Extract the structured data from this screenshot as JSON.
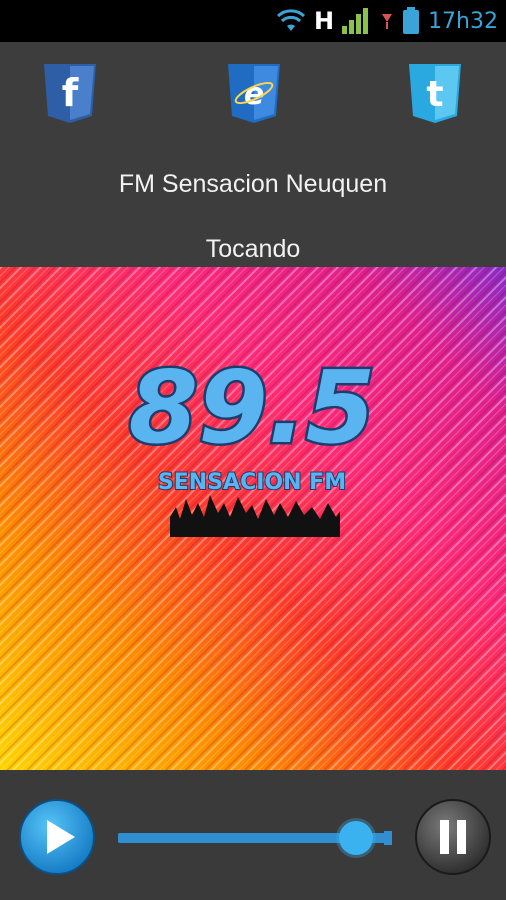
{
  "status_bar": {
    "time": "17h32",
    "network_label": "H",
    "icons": [
      "wifi-icon",
      "signal-icon",
      "battery-icon"
    ]
  },
  "header": {
    "social": [
      {
        "name": "facebook",
        "glyph": "f",
        "color": "#3b6bb5"
      },
      {
        "name": "internet-explorer",
        "glyph": "e",
        "color": "#2f7fd1"
      },
      {
        "name": "twitter",
        "glyph": "t",
        "color": "#3ab9ee"
      }
    ],
    "station_name": "FM Sensacion Neuquen",
    "now_playing": "Tocando"
  },
  "artwork": {
    "frequency": "89.5",
    "brand": "SENSACION FM"
  },
  "player": {
    "volume_fraction": 0.87,
    "accent": "#3ab2ef"
  }
}
